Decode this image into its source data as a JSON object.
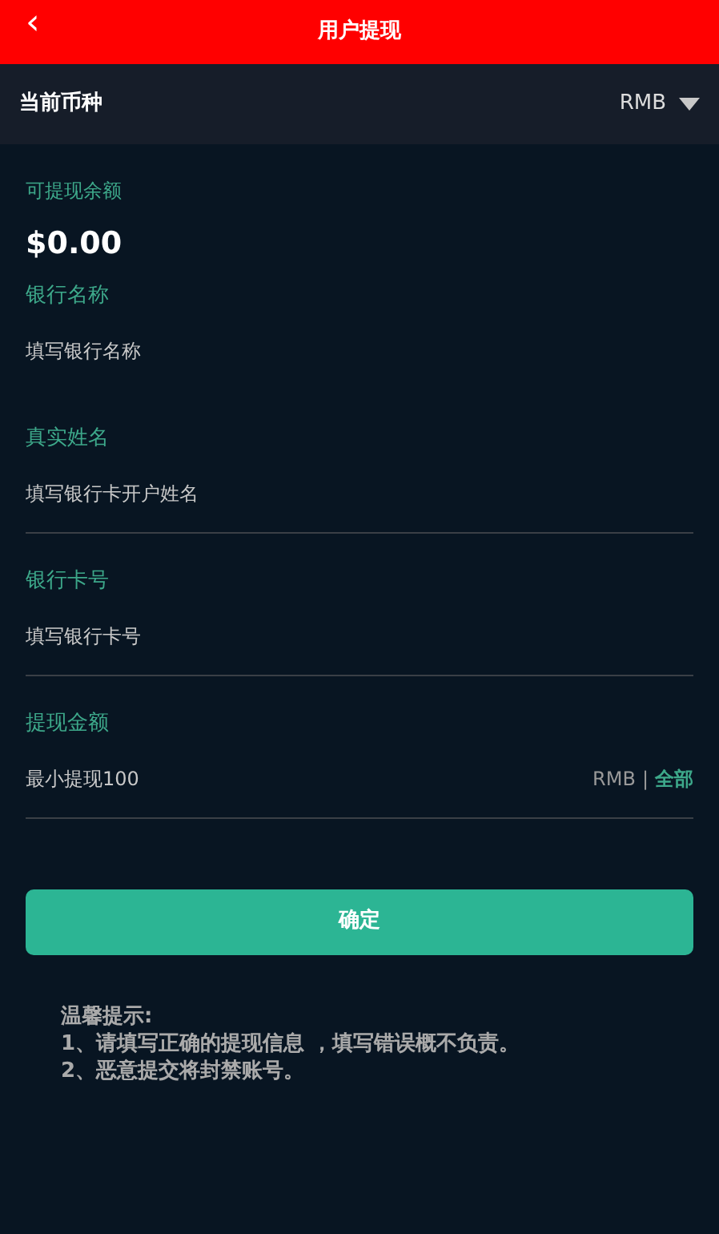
{
  "header": {
    "back": "‹",
    "title": "用户提现"
  },
  "currency": {
    "label": "当前币种",
    "value": "RMB"
  },
  "balance": {
    "label": "可提现余额",
    "amount": "$0.00"
  },
  "fields": [
    {
      "label": "银行名称",
      "placeholder": "填写银行名称",
      "divider": false
    },
    {
      "label": "真实姓名",
      "placeholder": "填写银行卡开户姓名",
      "divider": true
    },
    {
      "label": "银行卡号",
      "placeholder": "填写银行卡号",
      "divider": true
    },
    {
      "label": "提现金额",
      "placeholder": "最小提现100",
      "divider": true,
      "unit": "RMB",
      "separator": "|",
      "action": "全部"
    }
  ],
  "submit": "确定",
  "tips": {
    "title": "温馨提示:",
    "lines": [
      "1、请填写正确的提现信息 ，填写错误概不负责。",
      "2、恶意提交将封禁账号。"
    ]
  }
}
